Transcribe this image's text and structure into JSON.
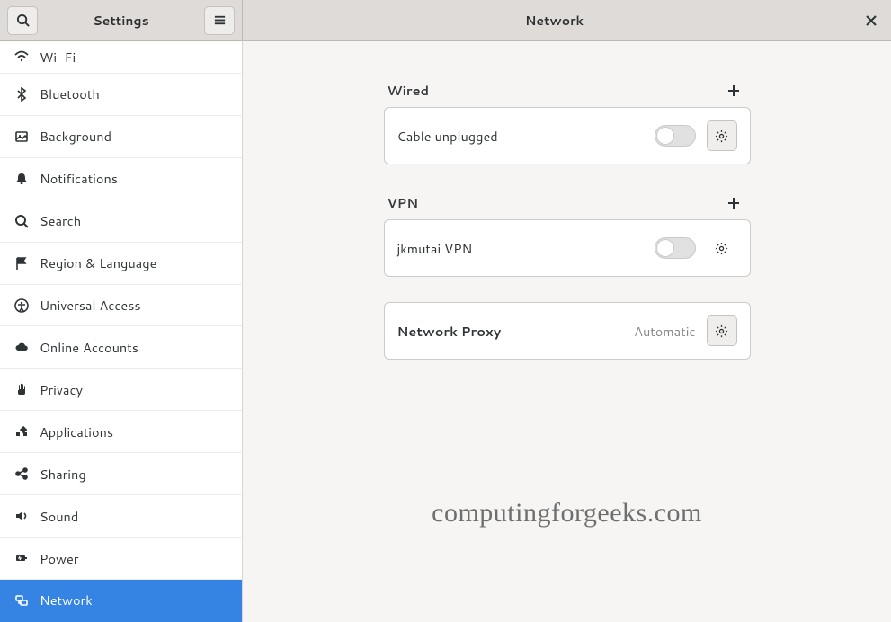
{
  "header": {
    "sidebar_title": "Settings",
    "content_title": "Network"
  },
  "sidebar": {
    "items": [
      {
        "id": "wifi",
        "label": "Wi-Fi",
        "icon": "wifi-icon",
        "active": false
      },
      {
        "id": "bluetooth",
        "label": "Bluetooth",
        "icon": "bluetooth-icon",
        "active": false
      },
      {
        "id": "background",
        "label": "Background",
        "icon": "background-icon",
        "active": false
      },
      {
        "id": "notifications",
        "label": "Notifications",
        "icon": "bell-icon",
        "active": false
      },
      {
        "id": "search",
        "label": "Search",
        "icon": "search-icon",
        "active": false
      },
      {
        "id": "region",
        "label": "Region & Language",
        "icon": "flag-icon",
        "active": false
      },
      {
        "id": "universal",
        "label": "Universal Access",
        "icon": "accessibility-icon",
        "active": false
      },
      {
        "id": "online",
        "label": "Online Accounts",
        "icon": "cloud-icon",
        "active": false
      },
      {
        "id": "privacy",
        "label": "Privacy",
        "icon": "hand-icon",
        "active": false
      },
      {
        "id": "applications",
        "label": "Applications",
        "icon": "apps-icon",
        "active": false
      },
      {
        "id": "sharing",
        "label": "Sharing",
        "icon": "share-icon",
        "active": false
      },
      {
        "id": "sound",
        "label": "Sound",
        "icon": "speaker-icon",
        "active": false
      },
      {
        "id": "power",
        "label": "Power",
        "icon": "power-icon",
        "active": false
      },
      {
        "id": "network",
        "label": "Network",
        "icon": "network-icon",
        "active": true
      }
    ]
  },
  "content": {
    "wired": {
      "title": "Wired",
      "status": "Cable unplugged"
    },
    "vpn": {
      "title": "VPN",
      "entries": [
        {
          "name": "jkmutai VPN"
        }
      ]
    },
    "proxy": {
      "title": "Network Proxy",
      "value": "Automatic"
    }
  },
  "watermark": "computingforgeeks.com"
}
